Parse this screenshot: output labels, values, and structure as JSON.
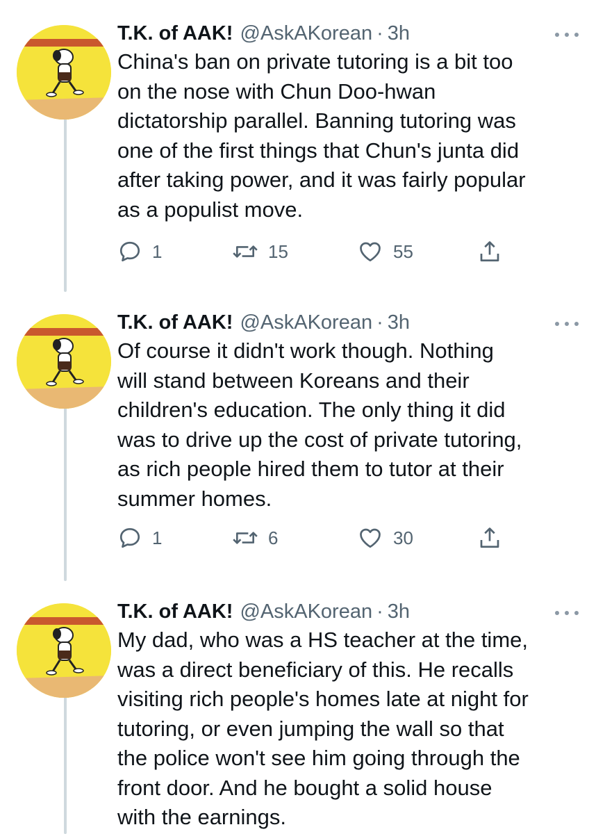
{
  "tweets": [
    {
      "author": {
        "name": "T.K. of AAK!",
        "handle": "@AskAKorean",
        "separator": "·",
        "time": "3h"
      },
      "lines": [
        "China's ban on private tutoring is a bit too",
        "on the nose with Chun Doo-hwan",
        "dictatorship parallel. Banning tutoring was",
        "one of the first things that Chun's junta did",
        "after taking power, and it was fairly popular",
        "as a populist move."
      ],
      "replies": "1",
      "retweets": "15",
      "likes": "55"
    },
    {
      "author": {
        "name": "T.K. of AAK!",
        "handle": "@AskAKorean",
        "separator": "·",
        "time": "3h"
      },
      "lines": [
        "Of course it didn't work though. Nothing",
        "will stand between Koreans and their",
        "children's education. The only thing it did",
        "was to drive up the cost of private tutoring,",
        "as rich people hired them to tutor at their",
        "summer homes."
      ],
      "replies": "1",
      "retweets": "6",
      "likes": "30"
    },
    {
      "author": {
        "name": "T.K. of AAK!",
        "handle": "@AskAKorean",
        "separator": "·",
        "time": "3h"
      },
      "lines": [
        "My dad, who was a HS teacher at the time,",
        "was a direct beneficiary of this. He recalls",
        "visiting rich people's homes late at night for",
        "tutoring, or even jumping the wall so that",
        "the police won't see him going through the",
        "front door. And he bought a solid house",
        "with the earnings."
      ]
    }
  ],
  "icons": {
    "reply": "reply-icon",
    "retweet": "retweet-icon",
    "like": "heart-icon",
    "share": "share-icon",
    "more": "more-icon"
  },
  "colors": {
    "text": "#0f1419",
    "secondary": "#536471",
    "thread_line": "#cfd9de",
    "avatar_bg": "#f5e33b"
  }
}
